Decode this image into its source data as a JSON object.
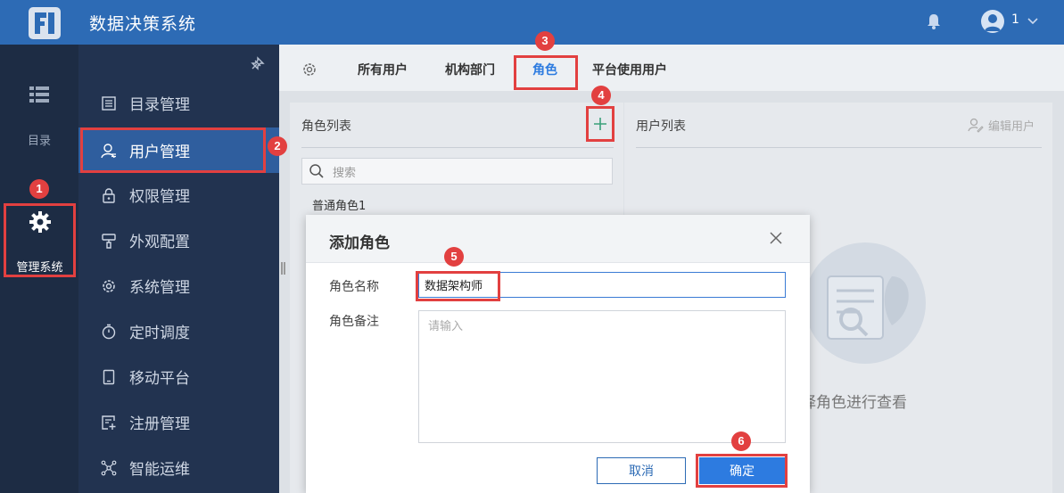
{
  "header": {
    "app_title": "数据决策系统",
    "user_name": "1",
    "brand_color": "#2d6bb5"
  },
  "rail": {
    "directory_label": "目录",
    "manage_label": "管理系统"
  },
  "menu": {
    "items": [
      {
        "label": "目录管理",
        "icon": "list-icon"
      },
      {
        "label": "用户管理",
        "icon": "user-icon",
        "active": true
      },
      {
        "label": "权限管理",
        "icon": "lock-icon"
      },
      {
        "label": "外观配置",
        "icon": "brush-icon"
      },
      {
        "label": "系统管理",
        "icon": "gear-icon"
      },
      {
        "label": "定时调度",
        "icon": "timer-icon"
      },
      {
        "label": "移动平台",
        "icon": "tablet-icon"
      },
      {
        "label": "注册管理",
        "icon": "register-icon"
      },
      {
        "label": "智能运维",
        "icon": "network-icon"
      }
    ]
  },
  "tabs": {
    "items": [
      "所有用户",
      "机构部门",
      "角色",
      "平台使用用户"
    ],
    "active": "角色"
  },
  "role_panel": {
    "title": "角色列表",
    "search_placeholder": "搜索",
    "roles": [
      "普通角色1"
    ]
  },
  "user_panel": {
    "title": "用户列表",
    "edit_label": "编辑用户",
    "empty_text": "择角色进行查看"
  },
  "dialog": {
    "title": "添加角色",
    "name_label": "角色名称",
    "name_value": "数据架构师",
    "remark_label": "角色备注",
    "remark_placeholder": "请输入",
    "cancel_label": "取消",
    "ok_label": "确定"
  },
  "steps": [
    "1",
    "2",
    "3",
    "4",
    "5",
    "6"
  ],
  "colors": {
    "highlight": "#e24040",
    "accent": "#2d7be0"
  }
}
